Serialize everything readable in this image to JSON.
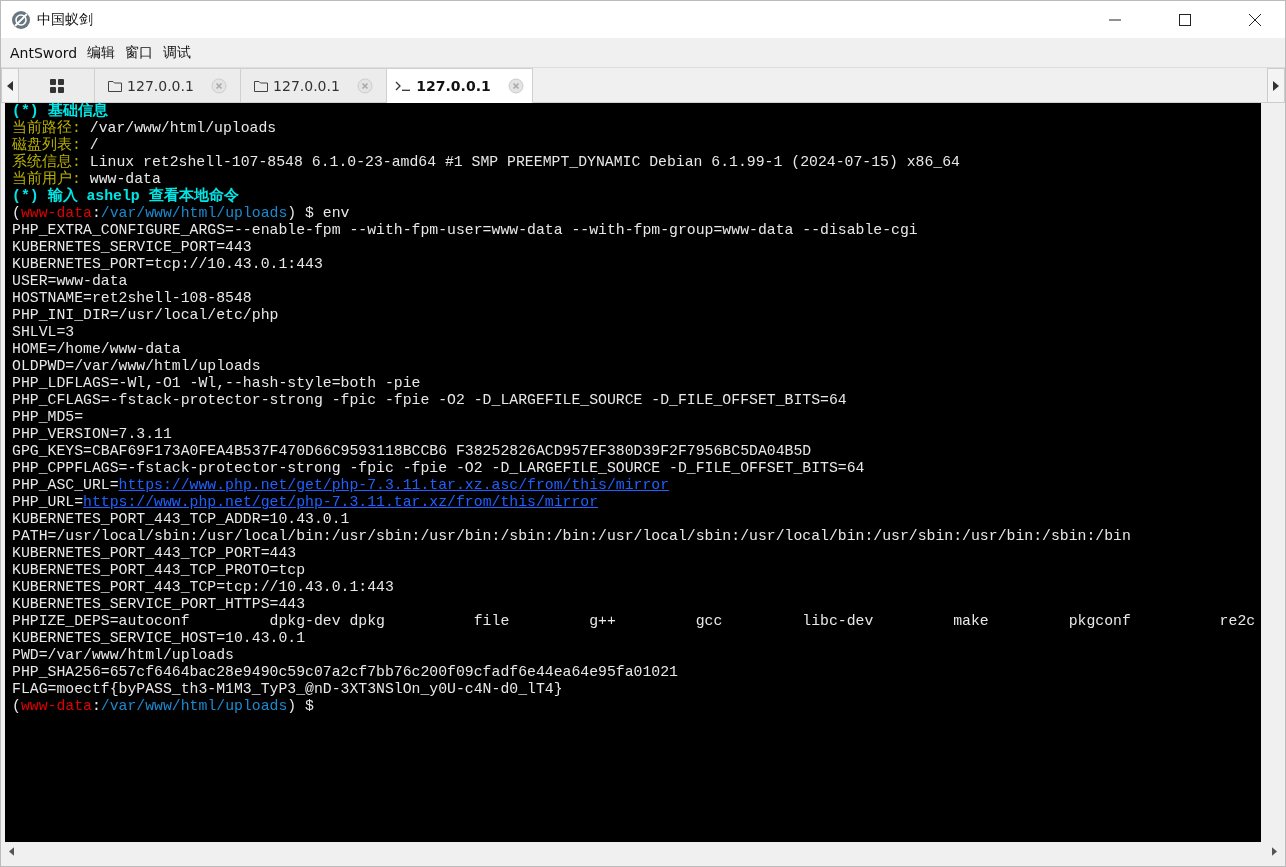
{
  "window": {
    "title": "中国蚁剑"
  },
  "menu": [
    "AntSword",
    "编辑",
    "窗口",
    "调试"
  ],
  "tabs": [
    {
      "kind": "home",
      "selected": false
    },
    {
      "kind": "folder",
      "label": "127.0.0.1",
      "selected": false
    },
    {
      "kind": "folder",
      "label": "127.0.0.1",
      "selected": false
    },
    {
      "kind": "terminal",
      "label": "127.0.0.1",
      "selected": true
    }
  ],
  "terminal": {
    "lines": [
      {
        "kind": "heading",
        "text": "(*) 基础信息"
      },
      {
        "kind": "info",
        "label": "当前路径:",
        "value": "/var/www/html/uploads"
      },
      {
        "kind": "info",
        "label": "磁盘列表:",
        "value": "/"
      },
      {
        "kind": "info",
        "label": "系统信息:",
        "value": "Linux ret2shell-107-8548 6.1.0-23-amd64 #1 SMP PREEMPT_DYNAMIC Debian 6.1.99-1 (2024-07-15) x86_64"
      },
      {
        "kind": "info",
        "label": "当前用户:",
        "value": "www-data"
      },
      {
        "kind": "heading",
        "text": "(*) 输入 ashelp 查看本地命令"
      },
      {
        "kind": "prompt",
        "open": "(",
        "user": "www-data",
        "colon": ":",
        "path": "/var/www/html/uploads",
        "close": ") $",
        "command": "env"
      },
      {
        "kind": "plain",
        "text": "PHP_EXTRA_CONFIGURE_ARGS=--enable-fpm --with-fpm-user=www-data --with-fpm-group=www-data --disable-cgi"
      },
      {
        "kind": "plain",
        "text": "KUBERNETES_SERVICE_PORT=443"
      },
      {
        "kind": "plain",
        "text": "KUBERNETES_PORT=tcp://10.43.0.1:443"
      },
      {
        "kind": "plain",
        "text": "USER=www-data"
      },
      {
        "kind": "plain",
        "text": "HOSTNAME=ret2shell-108-8548"
      },
      {
        "kind": "plain",
        "text": "PHP_INI_DIR=/usr/local/etc/php"
      },
      {
        "kind": "plain",
        "text": "SHLVL=3"
      },
      {
        "kind": "plain",
        "text": "HOME=/home/www-data"
      },
      {
        "kind": "plain",
        "text": "OLDPWD=/var/www/html/uploads"
      },
      {
        "kind": "plain",
        "text": "PHP_LDFLAGS=-Wl,-O1 -Wl,--hash-style=both -pie"
      },
      {
        "kind": "plain",
        "text": "PHP_CFLAGS=-fstack-protector-strong -fpic -fpie -O2 -D_LARGEFILE_SOURCE -D_FILE_OFFSET_BITS=64"
      },
      {
        "kind": "plain",
        "text": "PHP_MD5="
      },
      {
        "kind": "plain",
        "text": "PHP_VERSION=7.3.11"
      },
      {
        "kind": "plain",
        "text": "GPG_KEYS=CBAF69F173A0FEA4B537F470D66C9593118BCCB6 F38252826ACD957EF380D39F2F7956BC5DA04B5D"
      },
      {
        "kind": "plain",
        "text": "PHP_CPPFLAGS=-fstack-protector-strong -fpic -fpie -O2 -D_LARGEFILE_SOURCE -D_FILE_OFFSET_BITS=64"
      },
      {
        "kind": "link",
        "key": "PHP_ASC_URL=",
        "url": "https://www.php.net/get/php-7.3.11.tar.xz.asc/from/this/mirror"
      },
      {
        "kind": "link",
        "key": "PHP_URL=",
        "url": "https://www.php.net/get/php-7.3.11.tar.xz/from/this/mirror"
      },
      {
        "kind": "plain",
        "text": "KUBERNETES_PORT_443_TCP_ADDR=10.43.0.1"
      },
      {
        "kind": "plain",
        "text": "PATH=/usr/local/sbin:/usr/local/bin:/usr/sbin:/usr/bin:/sbin:/bin:/usr/local/sbin:/usr/local/bin:/usr/sbin:/usr/bin:/sbin:/bin"
      },
      {
        "kind": "plain",
        "text": "KUBERNETES_PORT_443_TCP_PORT=443"
      },
      {
        "kind": "plain",
        "text": "KUBERNETES_PORT_443_TCP_PROTO=tcp"
      },
      {
        "kind": "plain",
        "text": "KUBERNETES_PORT_443_TCP=tcp://10.43.0.1:443"
      },
      {
        "kind": "plain",
        "text": "KUBERNETES_SERVICE_PORT_HTTPS=443"
      },
      {
        "kind": "plain",
        "text": "PHPIZE_DEPS=autoconf         dpkg-dev dpkg          file         g++         gcc         libc-dev         make         pkgconf          re2c"
      },
      {
        "kind": "plain",
        "text": "KUBERNETES_SERVICE_HOST=10.43.0.1"
      },
      {
        "kind": "plain",
        "text": "PWD=/var/www/html/uploads"
      },
      {
        "kind": "plain",
        "text": "PHP_SHA256=657cf6464bac28e9490c59c07a2cf7bb76c200f09cfadf6e44ea64e95fa01021"
      },
      {
        "kind": "plain",
        "text": "FLAG=moectf{byPASS_th3-M1M3_TyP3_@nD-3XT3NSlOn_y0U-c4N-d0_lT4}"
      },
      {
        "kind": "prompt",
        "open": "(",
        "user": "www-data",
        "colon": ":",
        "path": "/var/www/html/uploads",
        "close": ") $"
      }
    ]
  }
}
